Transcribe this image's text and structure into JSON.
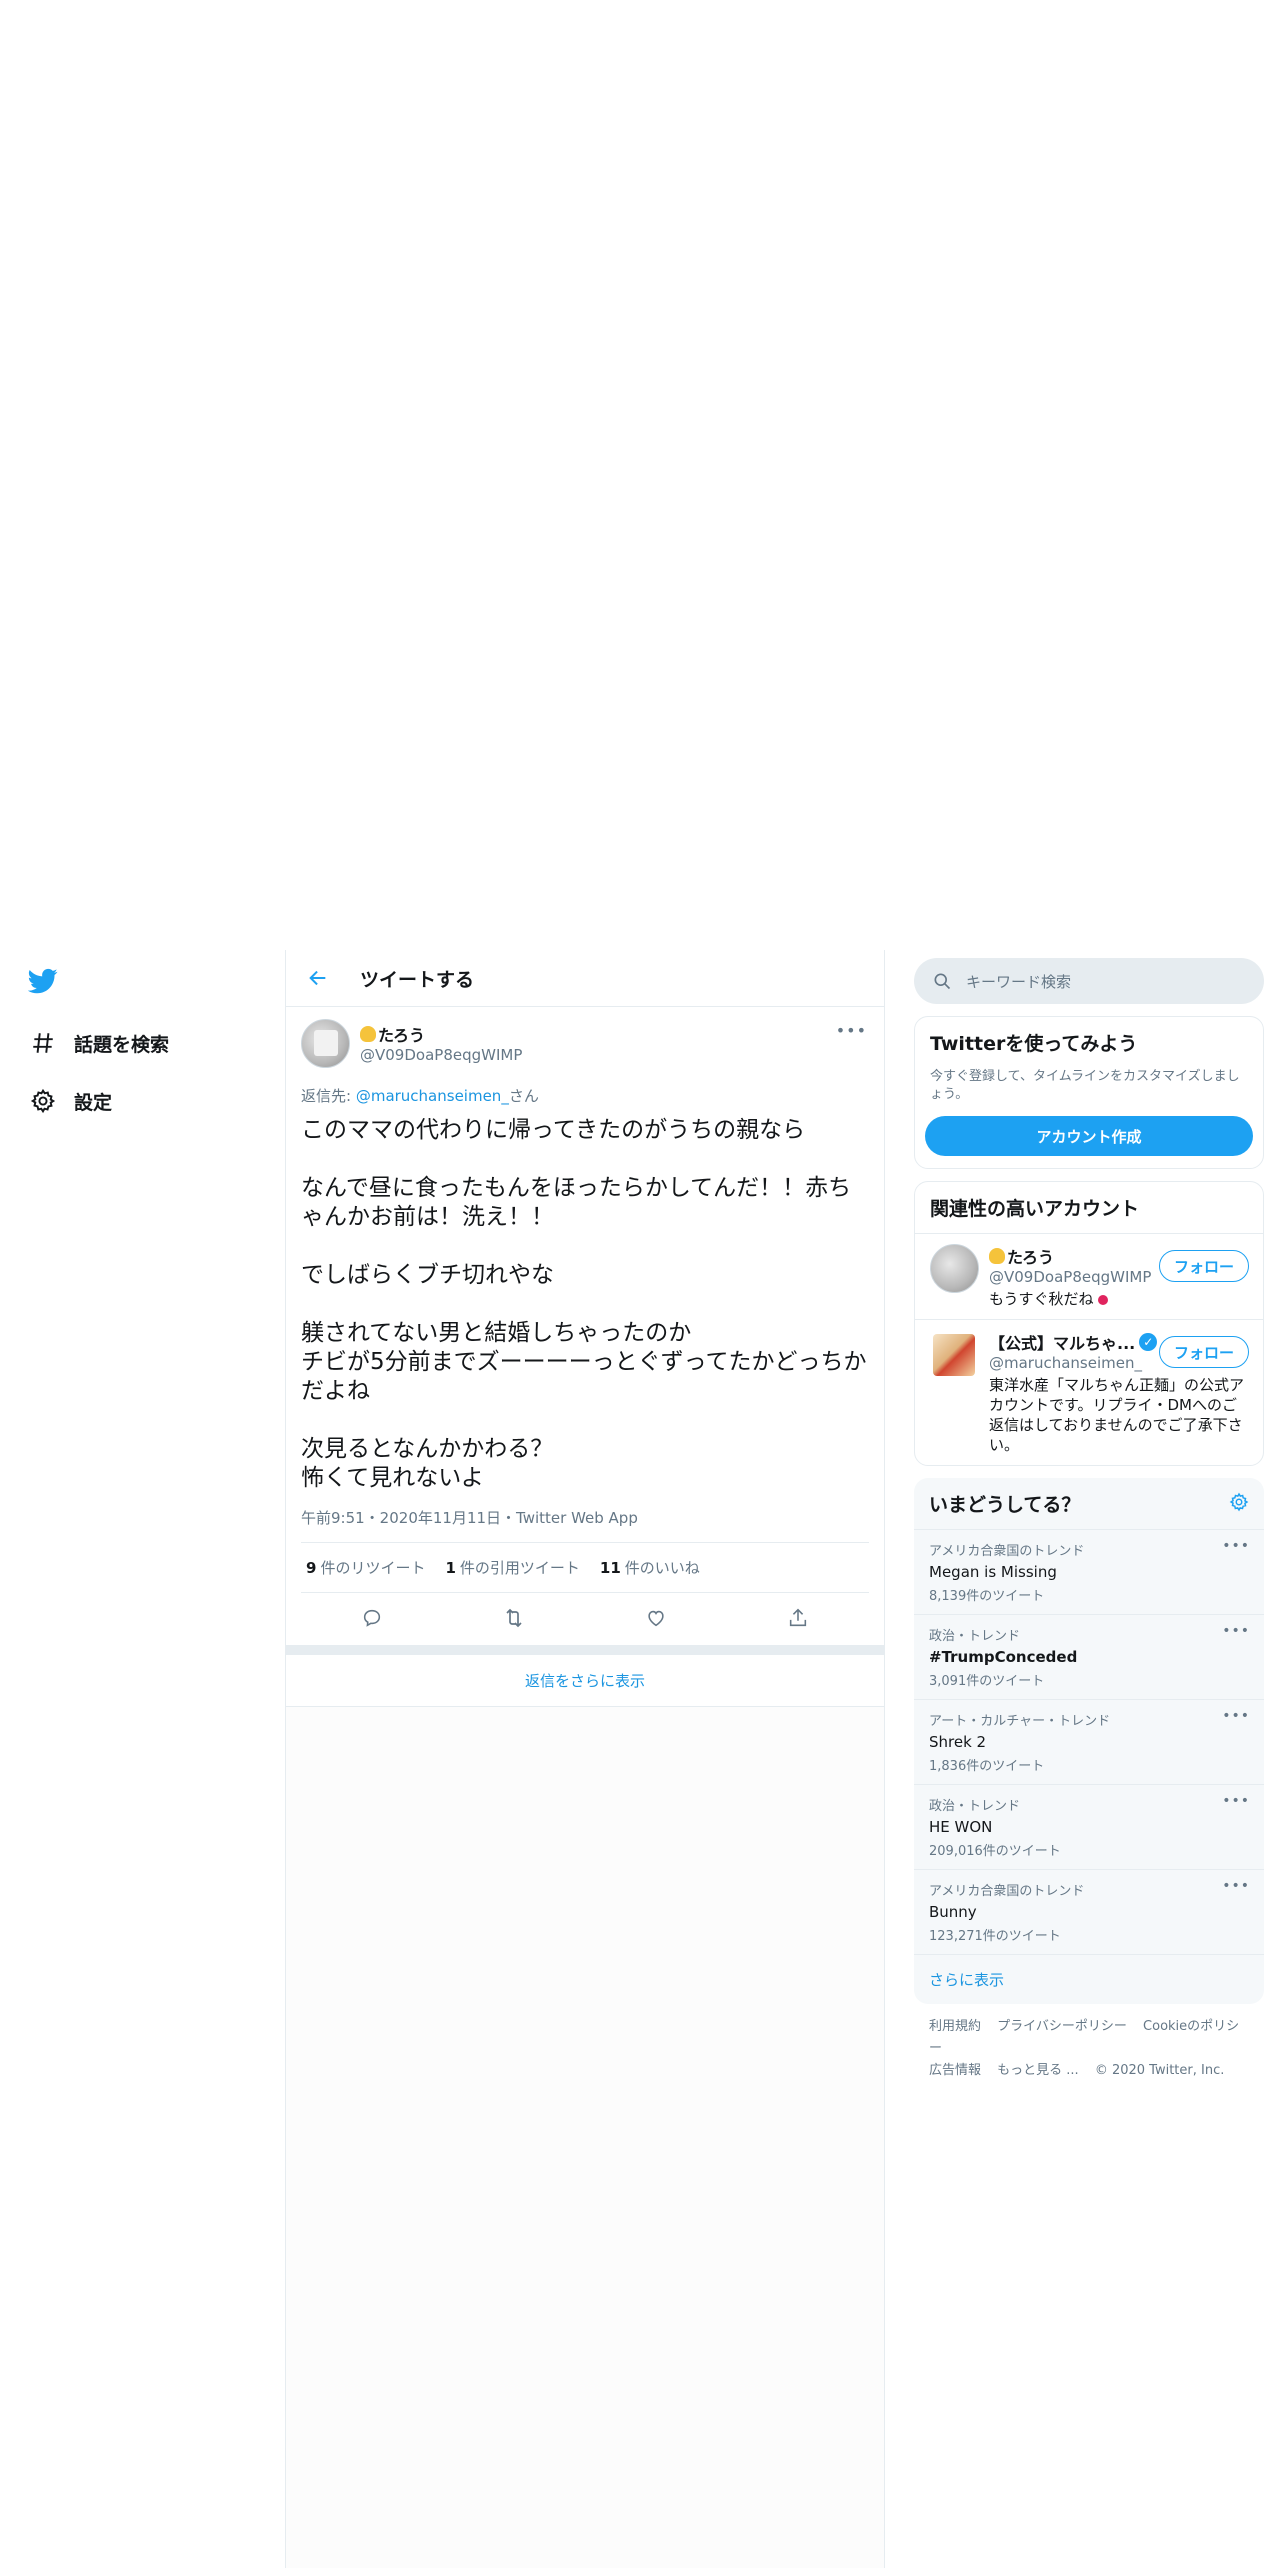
{
  "nav": {
    "logo": "twitter-bird-icon",
    "items": [
      {
        "label": "話題を検索",
        "icon": "hashtag-icon"
      },
      {
        "label": "設定",
        "icon": "gear-icon"
      }
    ]
  },
  "center": {
    "title": "ツイートする",
    "tweet": {
      "display_name": "たろう",
      "handle": "@V09DoaP8eqgWIMP",
      "reply_prefix": "返信先: ",
      "reply_mention": "@maruchanseimen_",
      "reply_suffix": "さん",
      "body": "このママの代わりに帰ってきたのがうちの親なら\n\nなんで昼に食ったもんをほったらかしてんだ！！赤ちゃんかお前は！洗え！！\n\nでしばらくブチ切れやな\n\n躾されてない男と結婚しちゃったのか\nチビが5分前までズーーーーっとぐずってたかどっちかだよね\n\n次見るとなんかかわる？\n怖くて見れないよ",
      "meta": "午前9:51・2020年11月11日・Twitter Web App",
      "stats": {
        "retweets_count": "9",
        "retweets_label": "件のリツイート",
        "quotes_count": "1",
        "quotes_label": "件の引用ツイート",
        "likes_count": "11",
        "likes_label": "件のいいね"
      }
    },
    "show_more_replies": "返信をさらに表示"
  },
  "right": {
    "search_placeholder": "キーワード検索",
    "try_card": {
      "title": "Twitterを使ってみよう",
      "subtitle": "今すぐ登録して、タイムラインをカスタマイズしましょう。",
      "button": "アカウント作成"
    },
    "related": {
      "title": "関連性の高いアカウント",
      "accounts": [
        {
          "name": "たろう",
          "handle": "@V09DoaP8eqgWIMP",
          "bio": "もうすぐ秋だね",
          "follow": "フォロー"
        },
        {
          "name": "【公式】マルちゃ...",
          "handle": "@maruchanseimen_",
          "bio": "東洋水産「マルちゃん正麺」の公式アカウントです。リプライ・DMへのご返信はしておりませんのでご了承下さい。",
          "follow": "フォロー"
        }
      ]
    },
    "trends": {
      "title": "いまどうしてる？",
      "items": [
        {
          "context": "アメリカ合衆国のトレンド",
          "name": "Megan is Missing",
          "count": "8,139件のツイート"
        },
        {
          "context": "政治・トレンド",
          "name": "#TrumpConceded",
          "count": "3,091件のツイート"
        },
        {
          "context": "アート・カルチャー・トレンド",
          "name": "Shrek 2",
          "count": "1,836件のツイート"
        },
        {
          "context": "政治・トレンド",
          "name": "HE WON",
          "count": "209,016件のツイート"
        },
        {
          "context": "アメリカ合衆国のトレンド",
          "name": "Bunny",
          "count": "123,271件のツイート"
        }
      ],
      "show_more": "さらに表示"
    },
    "footer": {
      "terms": "利用規約",
      "privacy": "プライバシーポリシー",
      "cookie": "Cookieのポリシー",
      "ads": "広告情報",
      "more": "もっと見る ...",
      "copyright": "© 2020 Twitter, Inc."
    }
  },
  "colors": {
    "accent": "#1da1f2",
    "link": "#1b95e0",
    "muted": "#657786",
    "border": "#e6ecf0"
  }
}
